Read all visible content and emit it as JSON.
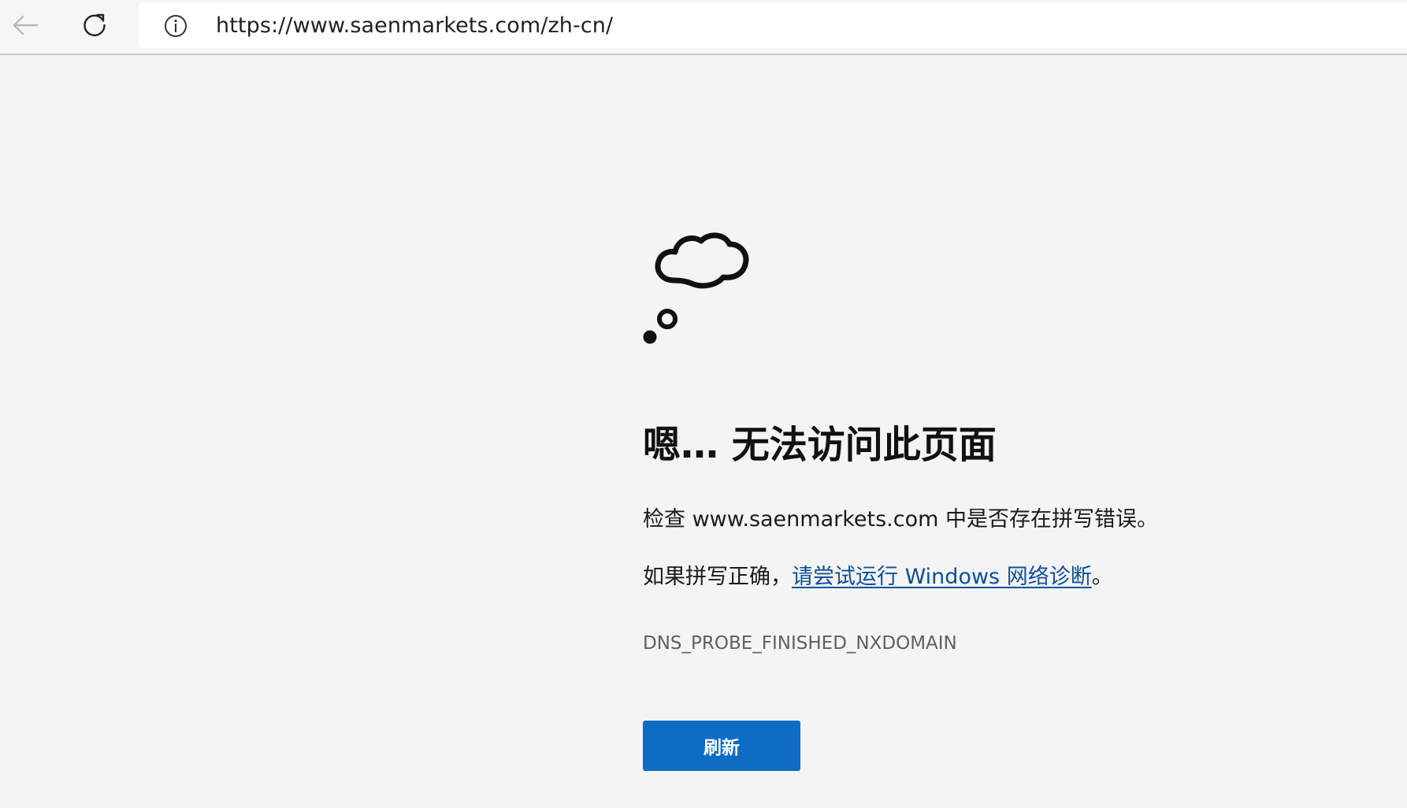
{
  "browser": {
    "address_bar": {
      "url": "https://www.saenmarkets.com/zh-cn/"
    },
    "icons": {
      "back": "back-arrow-icon",
      "refresh": "refresh-icon",
      "site_info": "info-icon"
    }
  },
  "error_page": {
    "icon": "thought-cloud-icon",
    "title": "嗯… 无法访问此页面",
    "check_prefix": "检查 ",
    "domain": "www.saenmarkets.com",
    "check_suffix": " 中是否存在拼写错误。",
    "spelling_prefix": "如果拼写正确，",
    "diagnostics_link": "请尝试运行 Windows 网络诊断",
    "spelling_suffix": "。",
    "error_code": "DNS_PROBE_FINISHED_NXDOMAIN",
    "refresh_button": "刷新"
  },
  "colors": {
    "accent": "#0f6cc4",
    "link": "#0f4f9a",
    "background": "#f4f4f4"
  }
}
